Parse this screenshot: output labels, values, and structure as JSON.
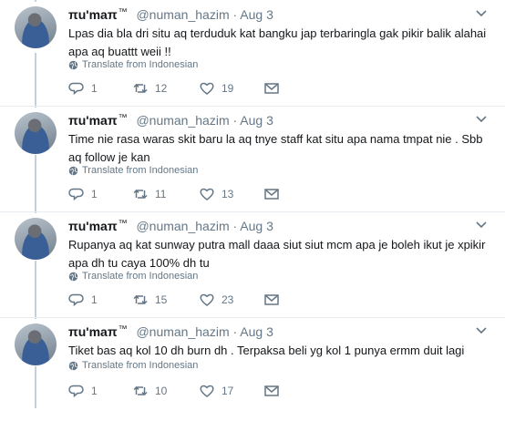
{
  "tweets": [
    {
      "name": "πu'maπ",
      "tm": "™",
      "handle": "@numan_hazim",
      "sep": "·",
      "time": "Aug 3",
      "text": "Lpas dia bla dri situ aq terduduk kat bangku jap terbaringla gak pikir balik alahai apa aq buattt weii !!",
      "translate": "Translate from Indonesian",
      "replies": "1",
      "retweets": "12",
      "likes": "19"
    },
    {
      "name": "πu'maπ",
      "tm": "™",
      "handle": "@numan_hazim",
      "sep": "·",
      "time": "Aug 3",
      "text": "Time nie rasa waras skit baru la aq tnye staff kat situ apa nama tmpat nie . Sbb aq follow je kan",
      "translate": "Translate from Indonesian",
      "replies": "1",
      "retweets": "11",
      "likes": "13"
    },
    {
      "name": "πu'maπ",
      "tm": "™",
      "handle": "@numan_hazim",
      "sep": "·",
      "time": "Aug 3",
      "text": "Rupanya aq kat sunway putra mall daaa siut siut mcm apa je boleh ikut je xpikir apa dh tu caya 100% dh tu",
      "translate": "Translate from Indonesian",
      "replies": "1",
      "retweets": "15",
      "likes": "23"
    },
    {
      "name": "πu'maπ",
      "tm": "™",
      "handle": "@numan_hazim",
      "sep": "·",
      "time": "Aug 3",
      "text": "Tiket bas aq kol 10 dh burn dh . Terpaksa beli yg kol 1 punya ermm duit lagi",
      "translate": "Translate from Indonesian",
      "replies": "1",
      "retweets": "10",
      "likes": "17"
    }
  ],
  "icons": {
    "caret": "chevron-down-icon",
    "globe": "globe-icon",
    "reply": "reply-icon",
    "retweet": "retweet-icon",
    "like": "heart-icon",
    "dm": "envelope-icon"
  }
}
